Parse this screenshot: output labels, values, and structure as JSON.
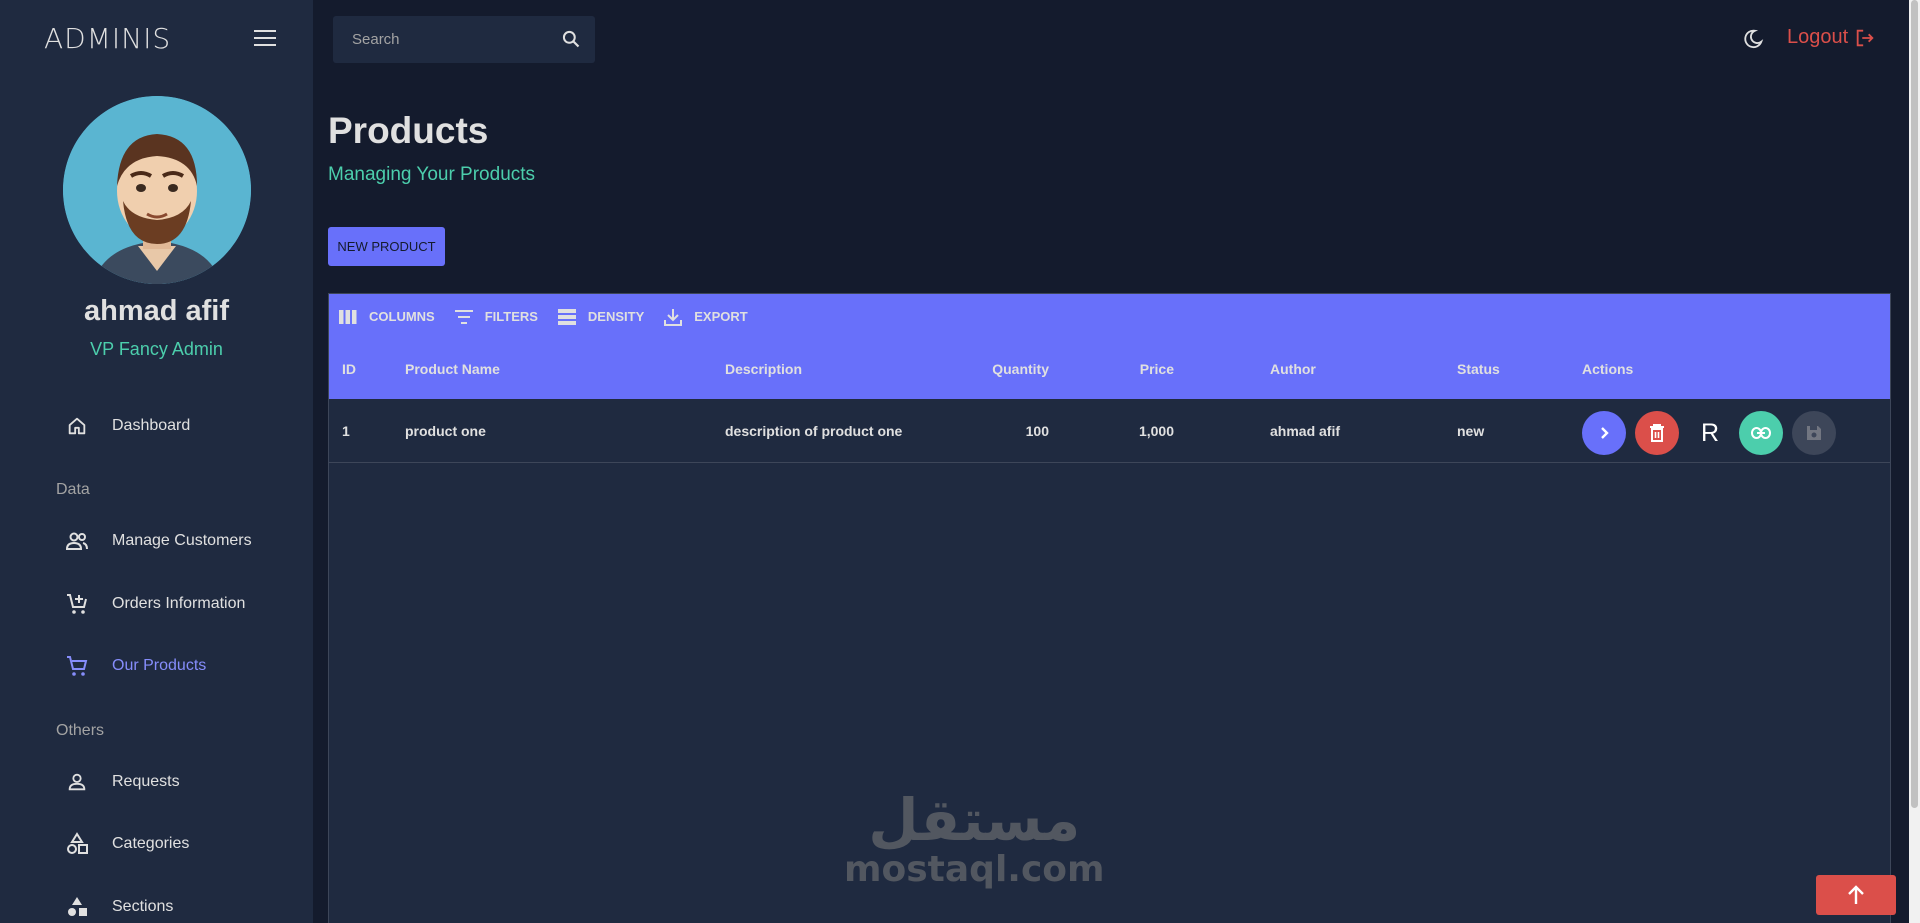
{
  "brand": "ADMINIS",
  "user": {
    "name": "ahmad afif",
    "role": "VP Fancy Admin"
  },
  "sidebar": {
    "items": [
      {
        "label": "Dashboard",
        "icon": "home-icon"
      },
      {
        "label": "Manage Customers",
        "icon": "people-icon"
      },
      {
        "label": "Orders Information",
        "icon": "cart-add-icon"
      },
      {
        "label": "Our Products",
        "icon": "cart-icon",
        "active": true
      },
      {
        "label": "Requests",
        "icon": "person-icon"
      },
      {
        "label": "Categories",
        "icon": "shapes-icon"
      },
      {
        "label": "Sections",
        "icon": "category-icon"
      }
    ],
    "sections": [
      "Data",
      "Others"
    ]
  },
  "search": {
    "placeholder": "Search"
  },
  "topbar": {
    "logout_label": "Logout"
  },
  "page": {
    "title": "Products",
    "subtitle": "Managing Your Products",
    "new_button": "NEW PRODUCT"
  },
  "toolbar": {
    "columns": "COLUMNS",
    "filters": "FILTERS",
    "density": "DENSITY",
    "export": "EXPORT"
  },
  "table": {
    "headers": [
      "ID",
      "Product Name",
      "Description",
      "Quantity",
      "Price",
      "Author",
      "Status",
      "Actions"
    ],
    "rows": [
      {
        "id": "1",
        "name": "product one",
        "description": "description of product one",
        "quantity": "100",
        "price": "1,000",
        "author": "ahmad afif",
        "status": "new",
        "action_letter": "R"
      }
    ]
  },
  "watermark": {
    "arabic": "مستقل",
    "latin": "mostaql.com"
  },
  "colors": {
    "sidebar_bg": "#1f2a40",
    "page_bg": "#141b2d",
    "accent": "#6870fa",
    "green": "#4cceac",
    "red": "#db4f4a",
    "active_nav": "#868dfb"
  }
}
